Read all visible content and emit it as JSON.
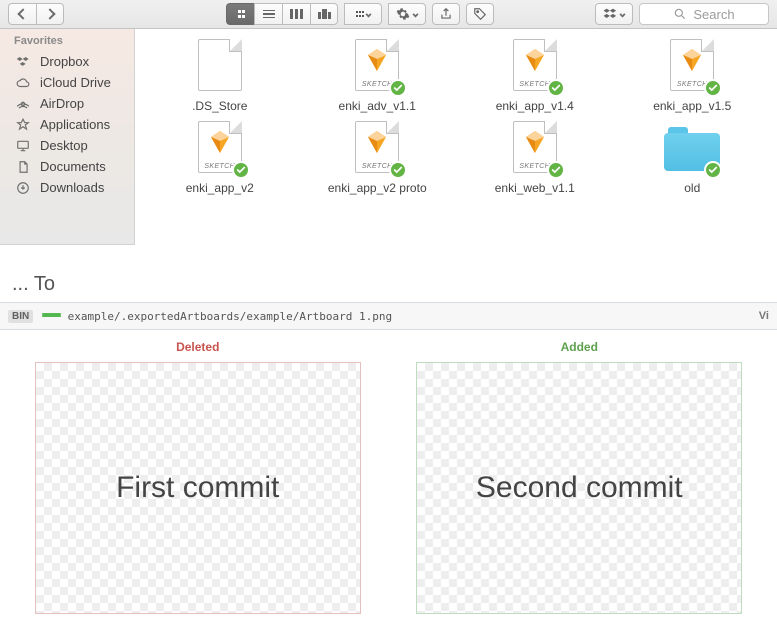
{
  "toolbar": {
    "search_placeholder": "Search"
  },
  "sidebar": {
    "section": "Favorites",
    "items": [
      {
        "label": "Dropbox",
        "icon": "dropbox-icon"
      },
      {
        "label": "iCloud Drive",
        "icon": "cloud-icon"
      },
      {
        "label": "AirDrop",
        "icon": "airdrop-icon"
      },
      {
        "label": "Applications",
        "icon": "applications-icon"
      },
      {
        "label": "Desktop",
        "icon": "desktop-icon"
      },
      {
        "label": "Documents",
        "icon": "documents-icon"
      },
      {
        "label": "Downloads",
        "icon": "downloads-icon"
      }
    ]
  },
  "files": [
    {
      "name": ".DS_Store",
      "kind": "blank",
      "synced": false
    },
    {
      "name": "enki_adv_v1.1",
      "kind": "sketch",
      "synced": true
    },
    {
      "name": "enki_app_v1.4",
      "kind": "sketch",
      "synced": true
    },
    {
      "name": "enki_app_v1.5",
      "kind": "sketch",
      "synced": true
    },
    {
      "name": "enki_app_v2",
      "kind": "sketch",
      "synced": true
    },
    {
      "name": "enki_app_v2 proto",
      "kind": "sketch",
      "synced": true
    },
    {
      "name": "enki_web_v1.1",
      "kind": "sketch",
      "synced": true
    },
    {
      "name": "old",
      "kind": "folder",
      "synced": true
    }
  ],
  "separator_title": "... To",
  "diff": {
    "badge": "BIN",
    "path": "example/.exportedArtboards/example/Artboard 1.png",
    "right_label": "Vi",
    "deleted_label": "Deleted",
    "added_label": "Added",
    "deleted_text": "First commit",
    "added_text": "Second commit"
  }
}
